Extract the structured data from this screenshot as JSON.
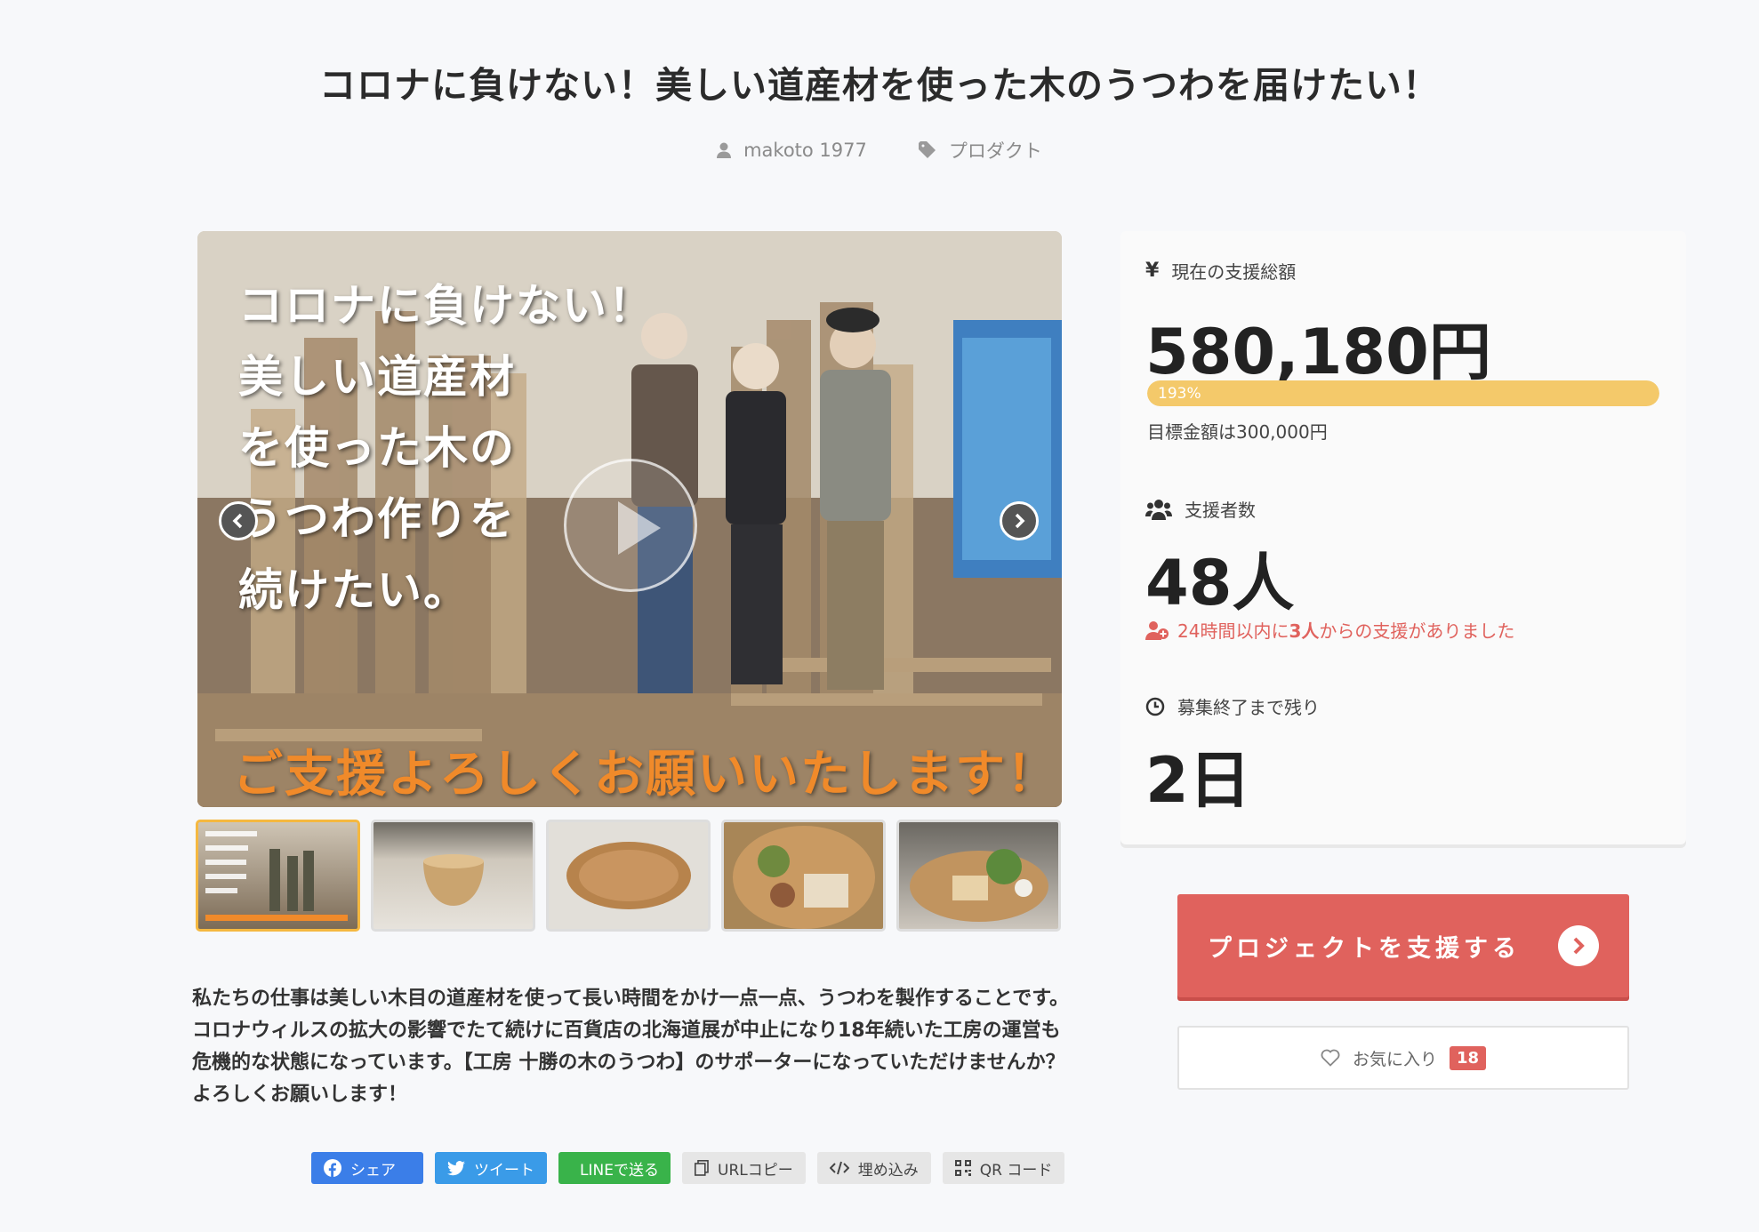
{
  "project": {
    "title": "コロナに負けない！美しい道産材を使った木のうつわを届けたい！",
    "owner": "makoto 1977",
    "category": "プロダクト",
    "description": "私たちの仕事は美しい木目の道産材を使って長い時間をかけ一点一点、うつわを製作することです。コロナウィルスの拡大の影響でたて続けに百貨店の北海道展が中止になり18年続いた工房の運営も危機的な状態になっています。【工房 十勝の木のうつわ】のサポーターになっていただけませんか？よろしくお願いします！"
  },
  "hero": {
    "lines": [
      "コロナに負けない！",
      "美しい道産材",
      "を使った木の",
      "うつわ作りを",
      "続けたい。"
    ],
    "sub": "ご支援よろしくお願いいたします！"
  },
  "icons": {
    "owner": "user-icon",
    "category": "tag-icon",
    "prev": "chevron-left-icon",
    "next": "chevron-right-icon",
    "play": "play-icon",
    "funding": "yen-icon",
    "backers": "users-icon",
    "recent": "user-plus-icon",
    "time": "clock-icon",
    "support": "chevron-right-circle-icon",
    "favorite": "heart-icon"
  },
  "stats": {
    "funding_label": "現在の支援総額",
    "funding_amount": "580,180円",
    "progress_text": "193%",
    "progress_value": 1.93,
    "goal_text": "目標金額は300,000円",
    "backers_label": "支援者数",
    "backers_count": "48人",
    "recent_prefix": "24時間以内に",
    "recent_count": "3人",
    "recent_suffix": "からの支援がありました",
    "time_label": "募集終了まで残り",
    "time_left": "2日"
  },
  "actions": {
    "support_label": "プロジェクトを支援する",
    "favorite_label": "お気に入り",
    "favorite_count": "18"
  },
  "share": {
    "facebook": "シェア",
    "twitter": "ツイート",
    "line": "LINEで送る",
    "url": "URLコピー",
    "embed": "埋め込み",
    "qr": "QR コード"
  },
  "colors": {
    "accent": "#e0625d",
    "progress": "#f4c96a",
    "facebook": "#3b7ee8",
    "twitter": "#3a9be8",
    "line": "#39b34a"
  }
}
